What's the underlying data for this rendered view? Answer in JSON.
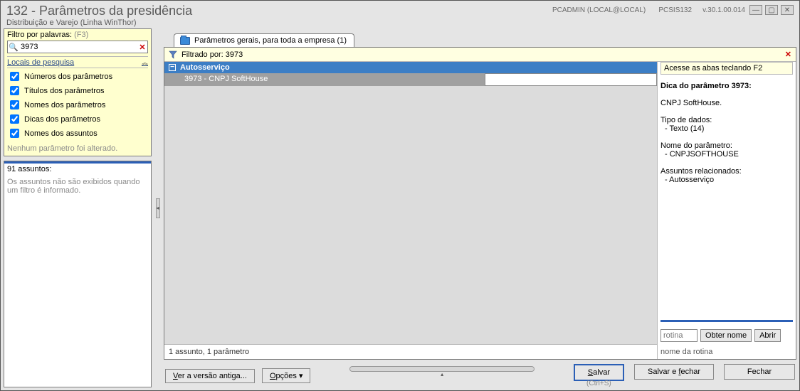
{
  "window": {
    "title": "132 - Parâmetros da presidência",
    "subtitle": "Distribuição e Varejo (Linha WinThor)",
    "user": "PCADMIN (LOCAL@LOCAL)",
    "module": "PCSIS132",
    "version": "v.30.1.00.014"
  },
  "filter": {
    "label": "Filtro por palavras:",
    "hint": "(F3)",
    "value": "3973",
    "locais_label": "Locais de pesquisa",
    "checks": {
      "numeros": "Números dos parâmetros",
      "titulos": "Títulos dos parâmetros",
      "nomes": "Nomes dos parâmetros",
      "dicas": "Dicas dos parâmetros",
      "assuntos": "Nomes dos assuntos"
    },
    "note": "Nenhum parâmetro foi alterado."
  },
  "assuntos": {
    "count_label": "91 assuntos:",
    "body": "Os assuntos não são exibidos quando um filtro é informado."
  },
  "tab": {
    "label": "Parâmetros gerais, para toda a empresa  (1)"
  },
  "filter_bar": {
    "text": "Filtrado por: 3973"
  },
  "grid": {
    "group": "Autosserviço",
    "row_label": "3973 - CNPJ SoftHouse",
    "status": "1 assunto, 1 parâmetro"
  },
  "hint": {
    "access": "Acesse as abas teclando F2",
    "title": "Dica do parâmetro 3973:",
    "desc": "CNPJ SoftHouse.",
    "dtype_label": "Tipo de dados:",
    "dtype_value": "- Texto (14)",
    "pname_label": "Nome do parâmetro:",
    "pname_value": "- CNPJSOFTHOUSE",
    "rel_label": "Assuntos relacionados:",
    "rel_value": "- Autosserviço",
    "rotina_placeholder": "rotina",
    "routine_label": "nome da rotina",
    "btn_obter": "Obter nome",
    "btn_abrir": "Abrir"
  },
  "footer": {
    "versao": "Ver a versão antiga...",
    "opcoes": "Opções ▾",
    "salvar": "Salvar",
    "salvar_shortcut": "(Ctrl+S)",
    "salvar_fechar": "Salvar e fechar",
    "fechar": "Fechar"
  }
}
